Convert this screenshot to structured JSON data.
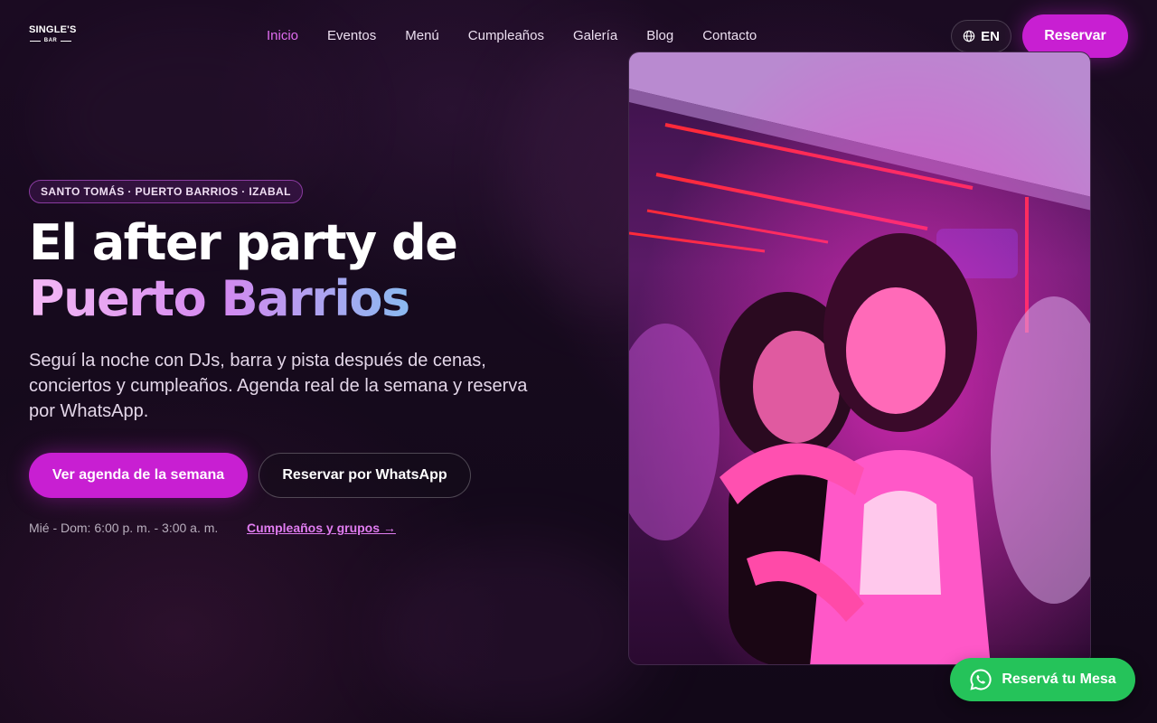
{
  "header": {
    "logo_top": "SINGLE'S",
    "logo_bottom": "BAR",
    "nav": [
      {
        "label": "Inicio",
        "active": true
      },
      {
        "label": "Eventos"
      },
      {
        "label": "Menú"
      },
      {
        "label": "Cumpleaños"
      },
      {
        "label": "Galería"
      },
      {
        "label": "Blog"
      },
      {
        "label": "Contacto"
      }
    ],
    "lang_label": "EN",
    "reserve_label": "Reservar"
  },
  "hero": {
    "badge": "SANTO TOMÁS · PUERTO BARRIOS · IZABAL",
    "title_line1": "El after party de",
    "title_line2": "Puerto Barrios",
    "subtitle": "Seguí la noche con DJs, barra y pista después de cenas, conciertos y cumpleaños. Agenda real de la semana y reserva por WhatsApp.",
    "cta_primary": "Ver agenda de la semana",
    "cta_secondary": "Reservar por WhatsApp",
    "hours": "Mié - Dom: 6:00 p. m. - 3:00 a. m.",
    "birthday_link": "Cumpleaños y grupos →"
  },
  "floating": {
    "whatsapp_label": "Reservá tu Mesa"
  },
  "colors": {
    "accent": "#c81fd2",
    "nav_active": "#e06cf0",
    "whatsapp": "#25c35a"
  }
}
